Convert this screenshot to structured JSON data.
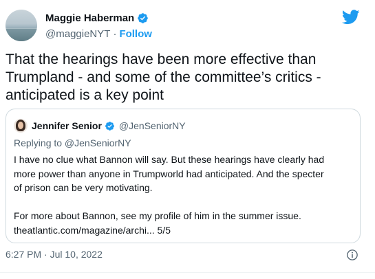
{
  "tweet": {
    "author": {
      "name": "Maggie Haberman",
      "handle": "@maggieNYT"
    },
    "follow_label": "Follow",
    "separator": "·",
    "text_lines": [
      "That the hearings have been more effective than",
      "Trumpland - and some of the committee’s critics -",
      "anticipated is a key point"
    ],
    "timestamp": "6:27 PM · Jul 10, 2022"
  },
  "quoted": {
    "author": {
      "name": "Jennifer Senior",
      "handle": "@JenSeniorNY"
    },
    "replying_to": "Replying to @JenSeniorNY",
    "paragraph_1": [
      "I have no clue what Bannon will say. But these hearings have clearly had",
      "more power than anyone in Trumpworld had anticipated. And the specter",
      "of prison can be very motivating."
    ],
    "paragraph_2": [
      "For more about Bannon, see my profile of him in the summer issue.",
      "theatlantic.com/magazine/archi...  5/5"
    ]
  },
  "colors": {
    "accent": "#1d9bf0",
    "text": "#0f1419",
    "muted": "#536471",
    "border": "#cfd9de"
  },
  "icons": [
    "verified-badge-icon",
    "twitter-bird-icon",
    "info-icon"
  ]
}
